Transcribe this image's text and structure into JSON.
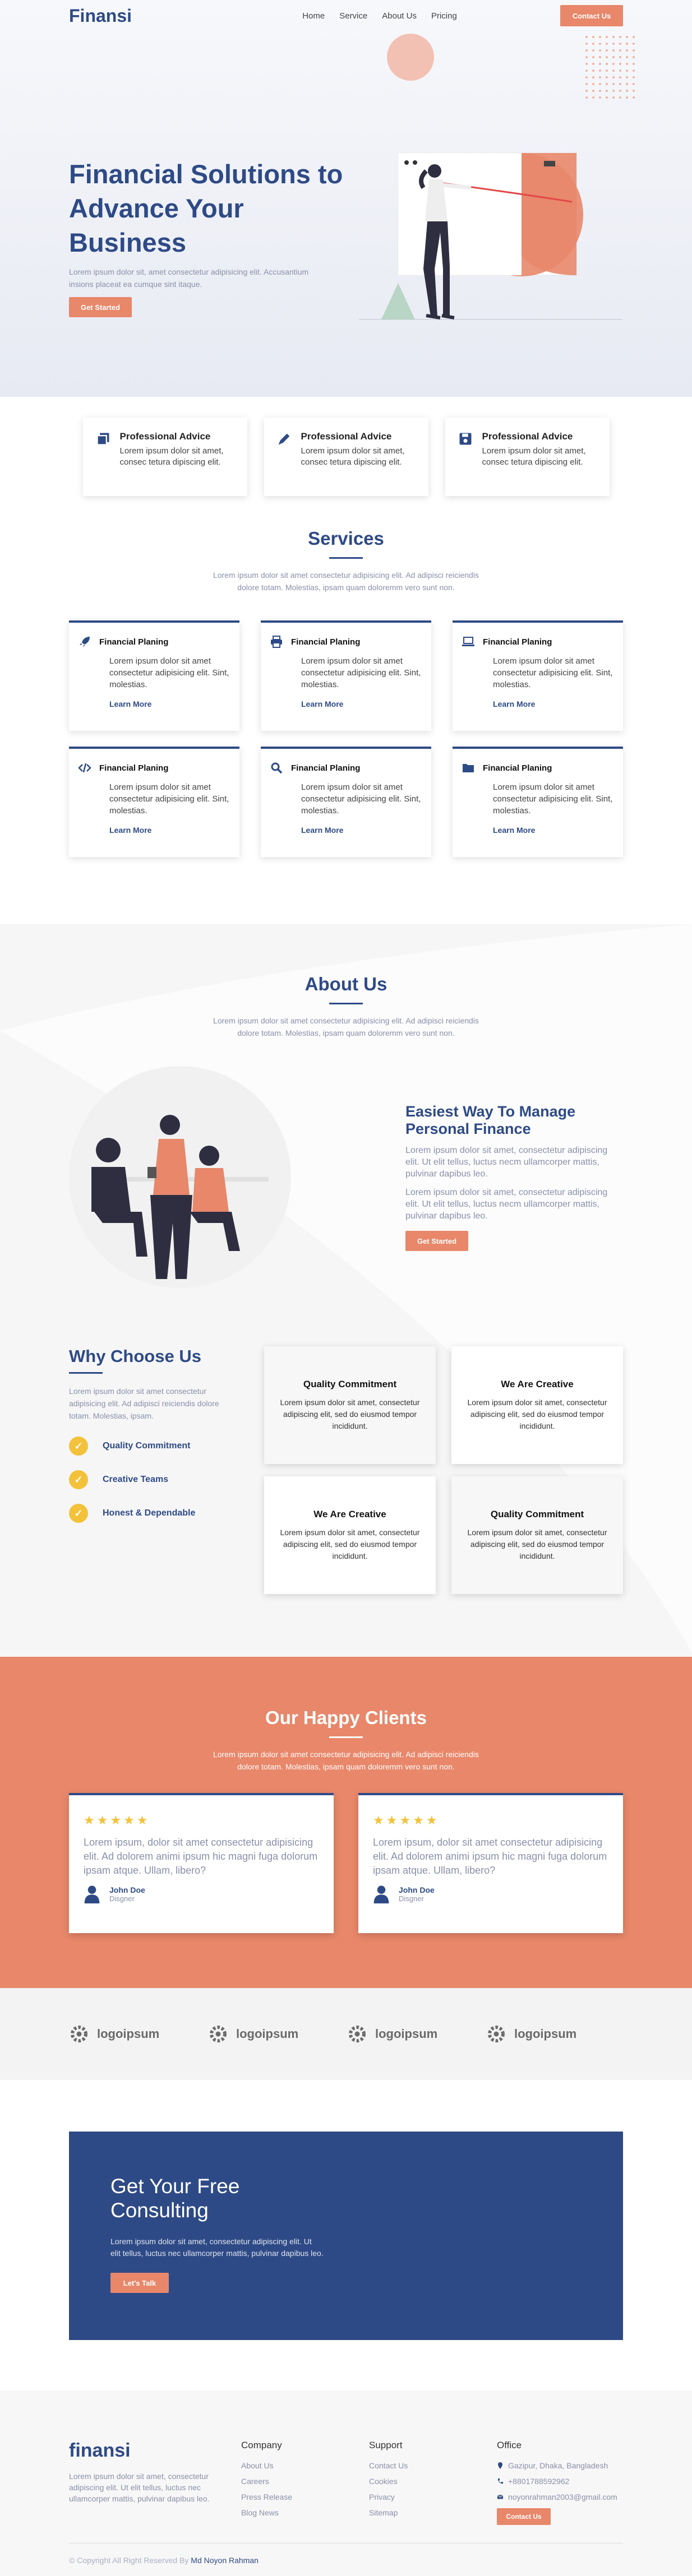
{
  "brand": "Finansi",
  "nav": {
    "links": [
      "Home",
      "Service",
      "About Us",
      "Pricing"
    ],
    "contact_label": "Contact Us"
  },
  "hero": {
    "title": "Financial Solutions to Advance Your Business",
    "subtitle": "Lorem ipsum dolor sit, amet consectetur adipisicing elit. Accusantium insions placeat ea cumque sint itaque.",
    "cta": "Get Started"
  },
  "features": [
    {
      "title": "Professional Advice",
      "text": "Lorem ipsum dolor sit amet, consec tetura dipiscing elit.",
      "icon": "copy-icon"
    },
    {
      "title": "Professional Advice",
      "text": "Lorem ipsum dolor sit amet, consec tetura dipiscing elit.",
      "icon": "pen-icon"
    },
    {
      "title": "Professional Advice",
      "text": "Lorem ipsum dolor sit amet, consec tetura dipiscing elit.",
      "icon": "save-icon"
    }
  ],
  "services": {
    "title": "Services",
    "subtitle": "Lorem ipsum dolor sit amet consectetur adipisicing elit. Ad adipisci reiciendis dolore totam. Molestias, ipsam quam doloremm vero sunt non.",
    "items": [
      {
        "title": "Financial Planing",
        "text": "Lorem ipsum dolor sit amet consectetur adipisicing elit. Sint, molestias.",
        "link": "Learn More",
        "icon": "rocket-icon"
      },
      {
        "title": "Financial Planing",
        "text": "Lorem ipsum dolor sit amet consectetur adipisicing elit. Sint, molestias.",
        "link": "Learn More",
        "icon": "printer-icon"
      },
      {
        "title": "Financial Planing",
        "text": "Lorem ipsum dolor sit amet consectetur adipisicing elit. Sint, molestias.",
        "link": "Learn More",
        "icon": "laptop-icon"
      },
      {
        "title": "Financial Planing",
        "text": "Lorem ipsum dolor sit amet consectetur adipisicing elit. Sint, molestias.",
        "link": "Learn More",
        "icon": "code-icon"
      },
      {
        "title": "Financial Planing",
        "text": "Lorem ipsum dolor sit amet consectetur adipisicing elit. Sint, molestias.",
        "link": "Learn More",
        "icon": "search-icon"
      },
      {
        "title": "Financial Planing",
        "text": "Lorem ipsum dolor sit amet consectetur adipisicing elit. Sint, molestias.",
        "link": "Learn More",
        "icon": "folder-icon"
      }
    ]
  },
  "about": {
    "title": "About Us",
    "subtitle": "Lorem ipsum dolor sit amet consectetur adipisicing elit. Ad adipisci reiciendis dolore totam. Molestias, ipsam quam doloremm vero sunt non.",
    "heading": "Easiest Way To Manage Personal Finance",
    "para1": "Lorem ipsum dolor sit amet, consectetur adipiscing elit. Ut elit tellus, luctus necm ullamcorper mattis, pulvinar dapibus leo.",
    "para2": "Lorem ipsum dolor sit amet, consectetur adipiscing elit. Ut elit tellus, luctus necm ullamcorper mattis, pulvinar dapibus leo.",
    "cta": "Get Started"
  },
  "why": {
    "title": "Why Choose Us",
    "text": "Lorem ipsum dolor sit amet consectetur adipisicing elit. Ad adipisci reiciendis dolore totam. Molestias, ipsam.",
    "points": [
      "Quality Commitment",
      "Creative Teams",
      "Honest & Dependable"
    ],
    "cards": [
      {
        "title": "Quality Commitment",
        "text": "Lorem ipsum dolor sit amet, consectetur adipiscing elit, sed do eiusmod tempor incididunt."
      },
      {
        "title": "We Are Creative",
        "text": "Lorem ipsum dolor sit amet, consectetur adipiscing elit, sed do eiusmod tempor incididunt."
      },
      {
        "title": "We Are Creative",
        "text": "Lorem ipsum dolor sit amet, consectetur adipiscing elit, sed do eiusmod tempor incididunt."
      },
      {
        "title": "Quality Commitment",
        "text": "Lorem ipsum dolor sit amet, consectetur adipiscing elit, sed do eiusmod tempor incididunt."
      }
    ]
  },
  "clients": {
    "title": "Our Happy Clients",
    "subtitle": "Lorem ipsum dolor sit amet consectetur adipisicing elit. Ad adipisci reiciendis dolore totam. Molestias, ipsam quam doloremm vero sunt non.",
    "testimonials": [
      {
        "stars": "★★★★★",
        "text": "Lorem ipsum, dolor sit amet consectetur adipisicing elit. Ad dolorem animi ipsum hic magni fuga dolorum ipsam atque. Ullam, libero?",
        "name": "John Doe",
        "role": "Disgner"
      },
      {
        "stars": "★★★★★",
        "text": "Lorem ipsum, dolor sit amet consectetur adipisicing elit. Ad dolorem animi ipsum hic magni fuga dolorum ipsam atque. Ullam, libero?",
        "name": "John Doe",
        "role": "Disgner"
      }
    ]
  },
  "logos": [
    "logoipsum",
    "logoipsum",
    "logoipsum",
    "logoipsum"
  ],
  "consult": {
    "title": "Get Your Free Consulting",
    "text": "Lorem ipsum dolor sit amet, consectetur adipiscing elit. Ut elit tellus, luctus nec ullamcorper mattis, pulvinar dapibus leo.",
    "cta": "Let's Talk"
  },
  "footer": {
    "logo": "finansi",
    "desc": "Lorem ipsum dolor sit amet, consectetur adipiscing elit. Ut elit tellus, luctus nec ullamcorper mattis, pulvinar dapibus leo.",
    "company": {
      "title": "Company",
      "links": [
        "About Us",
        "Careers",
        "Press Release",
        "Blog News"
      ]
    },
    "support": {
      "title": "Support",
      "links": [
        "Contact Us",
        "Cookies",
        "Privacy",
        "Sitemap"
      ]
    },
    "office": {
      "title": "Office",
      "address": "Gazipur, Dhaka, Bangladesh",
      "phone": "+8801788592962",
      "email": "noyonrahman2003@gmail.com",
      "cta": "Contact Us"
    },
    "copyright": "© Copyright All Right Reserved By",
    "author": "Md Noyon Rahman"
  },
  "colors": {
    "primary": "#2e4a86",
    "accent": "#e8876a",
    "star": "#f3c23a"
  }
}
